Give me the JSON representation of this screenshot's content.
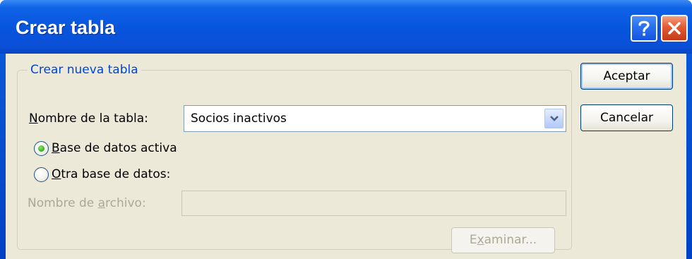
{
  "window": {
    "title": "Crear tabla",
    "help_icon": "question-mark-icon",
    "close_icon": "close-x-icon"
  },
  "group": {
    "legend": "Crear nueva tabla"
  },
  "table_name": {
    "label_pre": "",
    "label_accel": "N",
    "label_post": "ombre de la tabla:",
    "value": "Socios inactivos"
  },
  "radios": [
    {
      "accel": "B",
      "post": "ase de datos activa",
      "selected": true
    },
    {
      "accel": "O",
      "post": "tra base de datos:",
      "selected": false
    }
  ],
  "file_name": {
    "label_pre": "Nombre de ",
    "label_accel": "a",
    "label_post": "rchivo:",
    "value": ""
  },
  "buttons": {
    "browse_pre": "E",
    "browse_accel": "x",
    "browse_post": "aminar...",
    "ok": "Aceptar",
    "cancel": "Cancelar"
  },
  "colors": {
    "title_bar": "#0854dd",
    "legend": "#0046d5",
    "disabled_text": "#aca899",
    "dialog_bg": "#ece9d8"
  }
}
